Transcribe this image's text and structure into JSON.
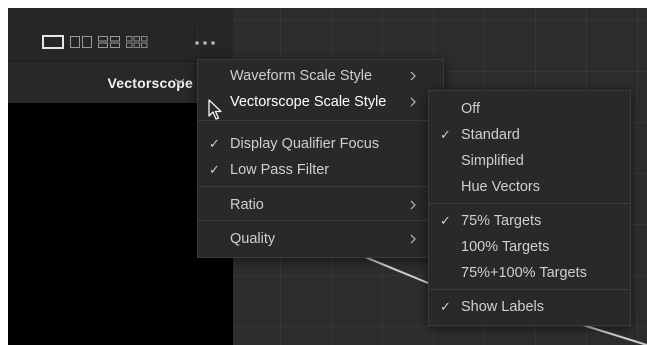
{
  "toolbar": {
    "layout_buttons": [
      "single-view-icon",
      "dual-view-icon",
      "quad-view-icon",
      "six-view-icon"
    ],
    "more_icon": "more-options-icon"
  },
  "scope": {
    "title": "Vectorscope"
  },
  "main_menu": {
    "items": [
      {
        "label": "Waveform Scale Style",
        "submenu": true
      },
      {
        "label": "Vectorscope Scale Style",
        "submenu": true,
        "highlighted": true
      },
      {
        "label": "Display Qualifier Focus",
        "checked": true
      },
      {
        "label": "Low Pass Filter",
        "checked": true
      },
      {
        "label": "Ratio",
        "submenu": true
      },
      {
        "label": "Quality",
        "submenu": true
      }
    ]
  },
  "sub_menu": {
    "items": [
      {
        "label": "Off"
      },
      {
        "label": "Standard",
        "checked": true
      },
      {
        "label": "Simplified"
      },
      {
        "label": "Hue Vectors"
      },
      {
        "label": "75% Targets",
        "checked": true
      },
      {
        "label": "100% Targets"
      },
      {
        "label": "75%+100% Targets"
      },
      {
        "label": "Show Labels",
        "checked": true
      }
    ]
  },
  "check_glyph": "✓",
  "colors": {
    "background": "#2d2d2f",
    "menu": "#29292b",
    "text": "#cfcfd1",
    "highlight_text": "#ffffff"
  }
}
